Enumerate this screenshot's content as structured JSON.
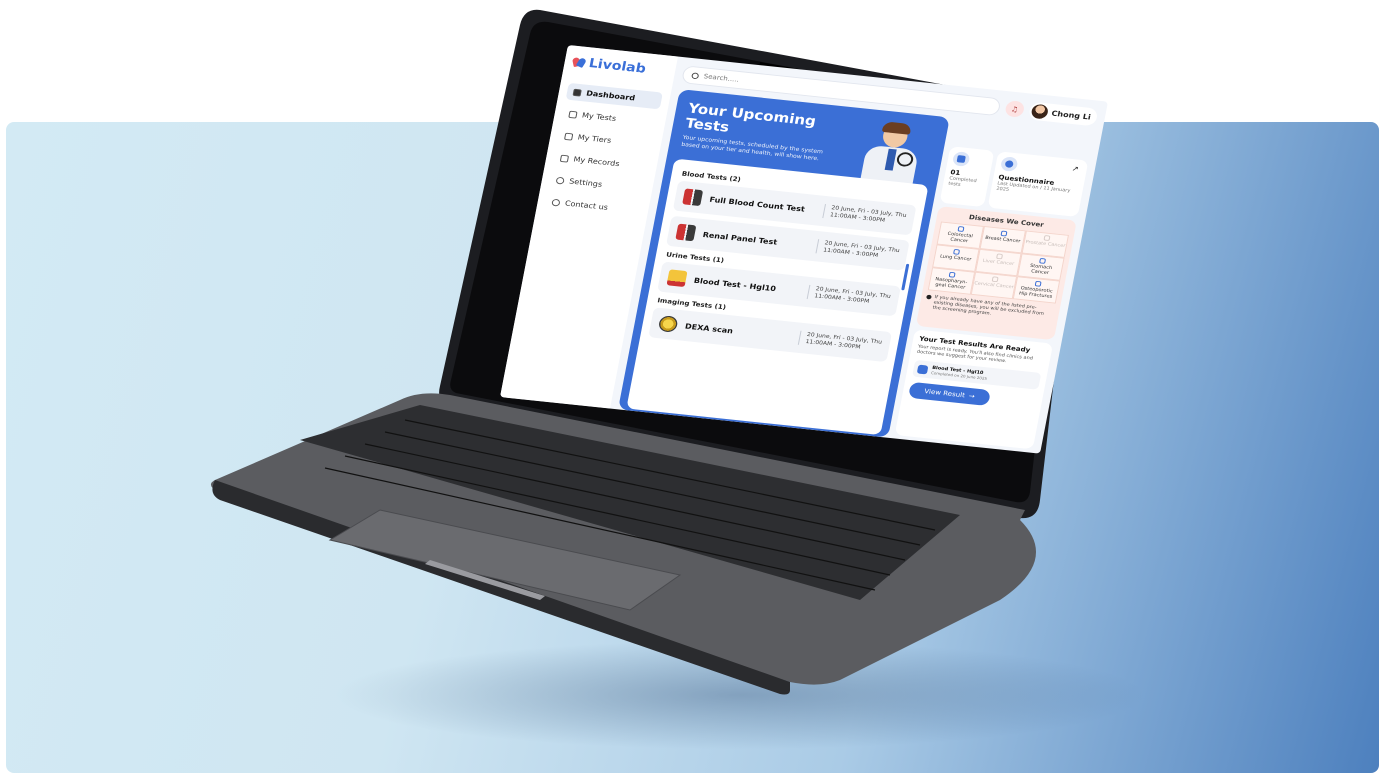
{
  "app": {
    "brand": "Livolab"
  },
  "colors": {
    "accent": "#3b6fd6",
    "accent_red": "#e8525a",
    "disease_bg": "#fdeae6"
  },
  "sidebar": {
    "items": [
      {
        "label": "Dashboard",
        "icon": "grid-icon",
        "active": true
      },
      {
        "label": "My Tests",
        "icon": "test-icon"
      },
      {
        "label": "My Tiers",
        "icon": "tier-icon"
      },
      {
        "label": "My Records",
        "icon": "records-icon"
      },
      {
        "label": "Settings",
        "icon": "gear-icon"
      },
      {
        "label": "Contact us",
        "icon": "phone-icon"
      }
    ]
  },
  "header": {
    "search_placeholder": "Search.....",
    "user_name": "Chong Li"
  },
  "upcoming": {
    "title": "Your Upcoming Tests",
    "subtitle": "Your upcoming tests, scheduled by the system based on your tier and health, will show here.",
    "groups": [
      {
        "label": "Blood Tests (2)",
        "tests": [
          {
            "name": "Full Blood Count Test",
            "date": "20 June, Fri - 03 July, Thu",
            "time": "11:00AM - 3:00PM"
          },
          {
            "name": "Renal Panel Test",
            "date": "20 June, Fri - 03 July, Thu",
            "time": "11:00AM - 3:00PM"
          }
        ]
      },
      {
        "label": "Urine Tests (1)",
        "tests": [
          {
            "name": "Blood Test - Hgl10",
            "date": "20 June, Fri - 03 July, Thu",
            "time": "11:00AM - 3:00PM"
          }
        ]
      },
      {
        "label": "Imaging Tests (1)",
        "tests": [
          {
            "name": "DEXA scan",
            "date": "20 June, Fri - 03 July, Thu",
            "time": "11:00AM - 3:00PM"
          }
        ]
      }
    ]
  },
  "stats": {
    "completed_count": "01",
    "completed_label": "Completed tests",
    "questionnaire_title": "Questionnaire",
    "questionnaire_sub": "Last Updated on / 11 January 2025"
  },
  "diseases": {
    "title": "Diseases We Cover",
    "cells": [
      {
        "label": "Colorectal Cancer",
        "dim": false
      },
      {
        "label": "Breast Cancer",
        "dim": false
      },
      {
        "label": "Prostate Cancer",
        "dim": true
      },
      {
        "label": "Lung Cancer",
        "dim": false
      },
      {
        "label": "Liver Cancer",
        "dim": true
      },
      {
        "label": "Stomach Cancer",
        "dim": false
      },
      {
        "label": "Nasopharyn-geal Cancer",
        "dim": false
      },
      {
        "label": "Cervical Cancer",
        "dim": true
      },
      {
        "label": "Osteoporotic Hip Fractures",
        "dim": false
      }
    ],
    "note": "If you already have any of the listed pre-existing diseases, you will be excluded from the screening program."
  },
  "results": {
    "title": "Your Test Results Are Ready",
    "subtitle": "Your report is ready. You'll also find clinics and doctors we suggest for your review.",
    "item_name": "Blood Test - Hgl10",
    "item_meta": "Completed on 20 June 2025",
    "button_label": "View Result"
  }
}
